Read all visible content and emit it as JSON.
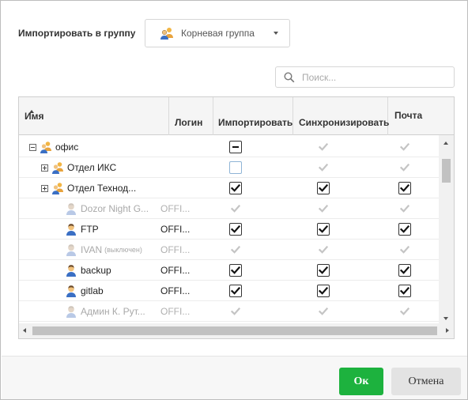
{
  "import_label": "Импортировать в группу",
  "group_select": {
    "value": "Корневая группа",
    "icon": "group-icon"
  },
  "search": {
    "placeholder": "Поиск..."
  },
  "columns": {
    "name": "Имя",
    "login": "Логин",
    "import": "Импортировать",
    "sync": "Синхронизировать",
    "mail": "Почта"
  },
  "sort": {
    "column": "name",
    "direction": "ascending"
  },
  "rows": [
    {
      "label": "офис",
      "type": "group",
      "expander": "minus",
      "level": 0,
      "dim": false,
      "login": "",
      "import": "minus",
      "sync": "dis",
      "mail": "dis"
    },
    {
      "label": "Отдел ИКС",
      "type": "group",
      "expander": "plus",
      "level": 1,
      "dim": false,
      "login": "",
      "import": "empty",
      "sync": "dis",
      "mail": "dis"
    },
    {
      "label": "Отдел Технод...",
      "type": "group",
      "expander": "plus",
      "level": 1,
      "dim": false,
      "login": "",
      "import": "on",
      "sync": "on",
      "mail": "on"
    },
    {
      "label": "Dozor Night G...",
      "type": "user",
      "level": 2,
      "dim": true,
      "login": "OFFI...",
      "import": "dis",
      "sync": "dis",
      "mail": "dis"
    },
    {
      "label": "FTP",
      "type": "user",
      "level": 2,
      "dim": false,
      "login": "OFFI...",
      "import": "on",
      "sync": "on",
      "mail": "on"
    },
    {
      "label": "IVAN",
      "note": "(выключен)",
      "type": "user",
      "level": 2,
      "dim": true,
      "login": "OFFI...",
      "import": "dis",
      "sync": "dis",
      "mail": "dis"
    },
    {
      "label": "backup",
      "type": "user",
      "level": 2,
      "dim": false,
      "login": "OFFI...",
      "import": "on",
      "sync": "on",
      "mail": "on"
    },
    {
      "label": "gitlab",
      "type": "user",
      "level": 2,
      "dim": false,
      "login": "OFFI...",
      "import": "on",
      "sync": "on",
      "mail": "on"
    },
    {
      "label": "Админ К. Рут...",
      "type": "user",
      "level": 2,
      "dim": true,
      "login": "OFFI...",
      "import": "dis",
      "sync": "dis",
      "mail": "dis"
    }
  ],
  "buttons": {
    "ok": "Ок",
    "cancel": "Отмена"
  },
  "colors": {
    "ok": "#1db23e",
    "user_icon": "#3a6fc4",
    "group_icon": "#e8a33d"
  }
}
